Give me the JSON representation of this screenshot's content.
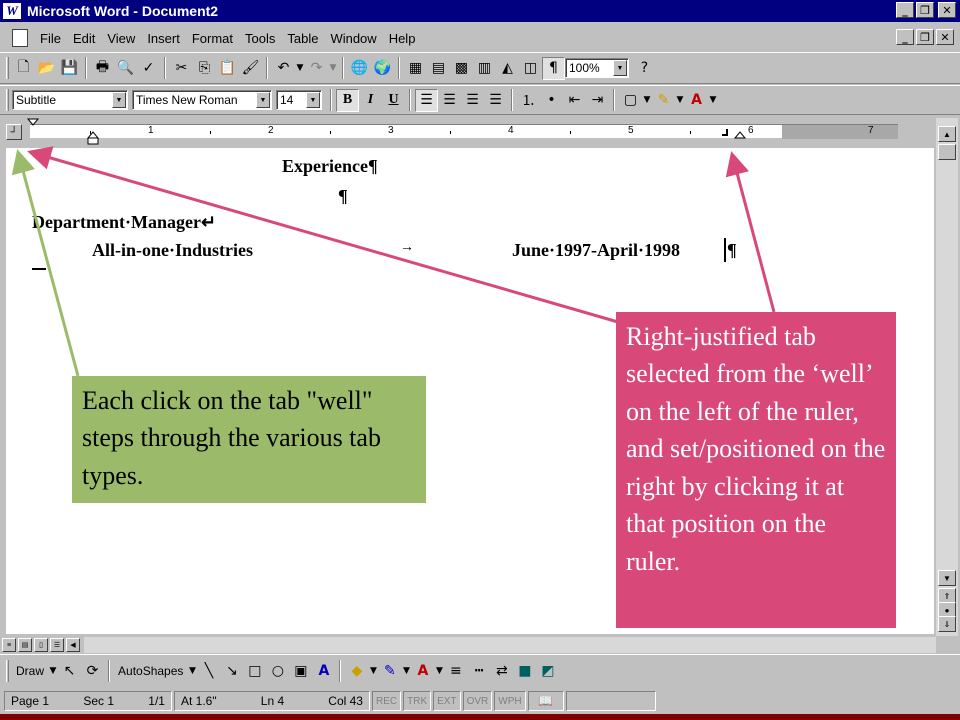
{
  "window": {
    "title": "Microsoft Word - Document2",
    "app_icon": "W"
  },
  "menu": {
    "items": [
      "File",
      "Edit",
      "View",
      "Insert",
      "Format",
      "Tools",
      "Table",
      "Window",
      "Help"
    ]
  },
  "standard_toolbar": {
    "zoom": "100%"
  },
  "formatting_toolbar": {
    "style": "Subtitle",
    "font": "Times New Roman",
    "size": "14",
    "bold": "B",
    "italic": "I",
    "underline": "U"
  },
  "ruler": {
    "numbers": [
      "1",
      "2",
      "3",
      "4",
      "5",
      "6",
      "7"
    ]
  },
  "document": {
    "heading": "Experience¶",
    "pilcrow": "¶",
    "job_title": "Department·Manager↵",
    "company": "All-in-one·Industries",
    "tab_arrow": "→",
    "dates": "June·1997-April·1998",
    "end_mark": "¶"
  },
  "drawing_toolbar": {
    "draw": "Draw",
    "autoshapes": "AutoShapes"
  },
  "status_bar": {
    "page": "Page 1",
    "sec": "Sec 1",
    "pages": "1/1",
    "at": "At 1.6\"",
    "ln": "Ln 4",
    "col": "Col 43",
    "modes": [
      "REC",
      "TRK",
      "EXT",
      "OVR",
      "WPH"
    ]
  },
  "callouts": {
    "green": "Each click on the tab \"well\" steps through the various tab types.",
    "pink": "Right-justified tab selected from the ‘well’ on the left of the ruler, and set/positioned on the right by clicking it at that position on the ruler."
  },
  "colors": {
    "green_callout": "#9bbb6a",
    "pink_callout": "#d8497a",
    "title_bar": "#000080"
  }
}
